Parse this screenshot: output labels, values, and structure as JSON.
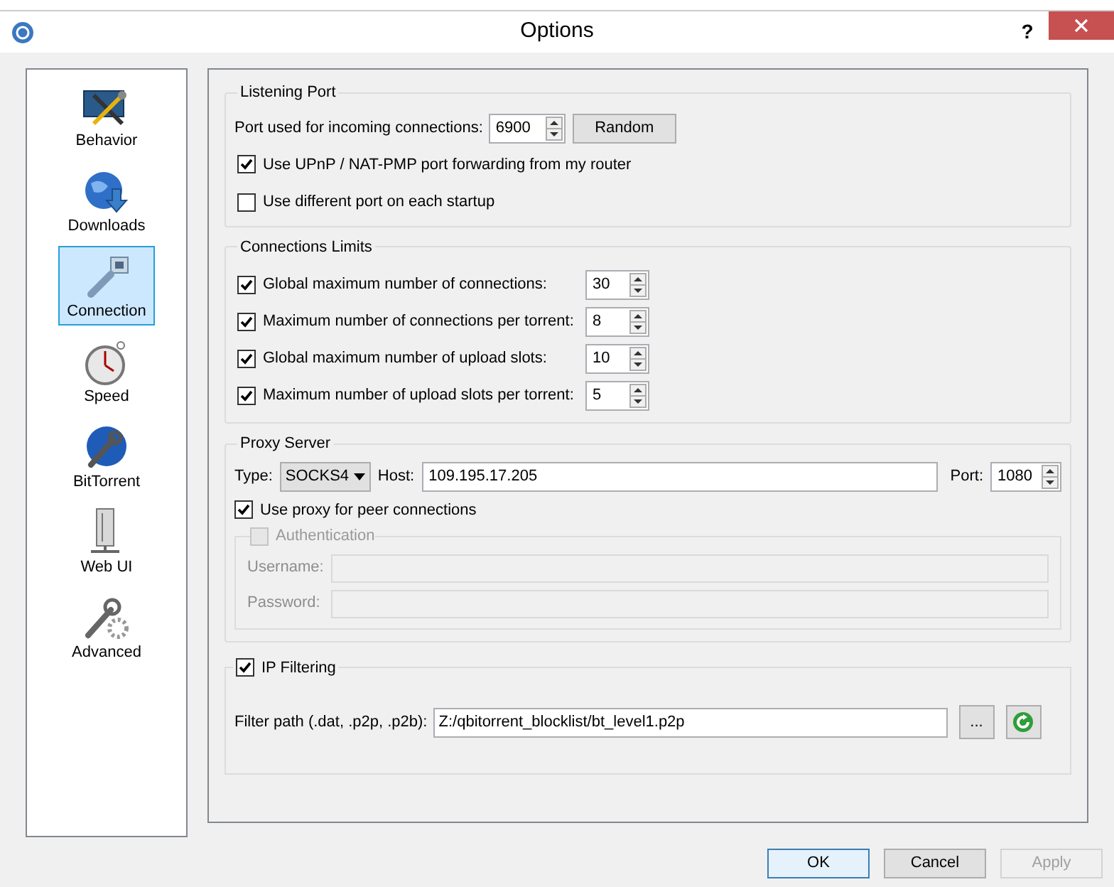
{
  "window": {
    "title": "Options",
    "help_button": "?"
  },
  "sidebar": {
    "items": [
      {
        "label": "Behavior",
        "kind": "behavior",
        "selected": false
      },
      {
        "label": "Downloads",
        "kind": "downloads",
        "selected": false
      },
      {
        "label": "Connection",
        "kind": "connection",
        "selected": true
      },
      {
        "label": "Speed",
        "kind": "speed",
        "selected": false
      },
      {
        "label": "BitTorrent",
        "kind": "bittorrent",
        "selected": false
      },
      {
        "label": "Web UI",
        "kind": "webui",
        "selected": false
      },
      {
        "label": "Advanced",
        "kind": "advanced",
        "selected": false
      }
    ]
  },
  "listening_port": {
    "title": "Listening Port",
    "port_label": "Port used for incoming connections:",
    "port_value": "6900",
    "random_button": "Random",
    "options": [
      {
        "label": "Use UPnP / NAT-PMP port forwarding from my router",
        "checked": true
      },
      {
        "label": "Use different port on each startup",
        "checked": false
      }
    ]
  },
  "connection_limits": {
    "title": "Connections Limits",
    "rows": [
      {
        "label": "Global maximum number of connections:",
        "checked": true,
        "value": "30"
      },
      {
        "label": "Maximum number of connections per torrent:",
        "checked": true,
        "value": "8"
      },
      {
        "label": "Global maximum number of upload slots:",
        "checked": true,
        "value": "10"
      },
      {
        "label": "Maximum number of upload slots per torrent:",
        "checked": true,
        "value": "5"
      }
    ]
  },
  "proxy_server": {
    "title": "Proxy Server",
    "type_label": "Type:",
    "type_value": "SOCKS4",
    "host_label": "Host:",
    "host_value": "109.195.17.205",
    "port_label": "Port:",
    "port_value": "1080",
    "use_proxy": {
      "label": "Use proxy for peer connections",
      "checked": true
    },
    "authentication": {
      "label": "Authentication",
      "checked": false,
      "disabled": true,
      "fields": [
        {
          "label": "Username:"
        },
        {
          "label": "Password:"
        }
      ]
    }
  },
  "ip_filtering": {
    "label": "IP Filtering",
    "checked": true,
    "path_label": "Filter path (.dat, .p2p, .p2b):",
    "path_value": "Z:/qbitorrent_blocklist/bt_level1.p2p",
    "browse_button": "..."
  },
  "buttons": [
    {
      "label": "OK",
      "disabled": false,
      "focused": true
    },
    {
      "label": "Cancel",
      "disabled": false,
      "focused": false
    },
    {
      "label": "Apply",
      "disabled": true,
      "focused": false
    }
  ]
}
